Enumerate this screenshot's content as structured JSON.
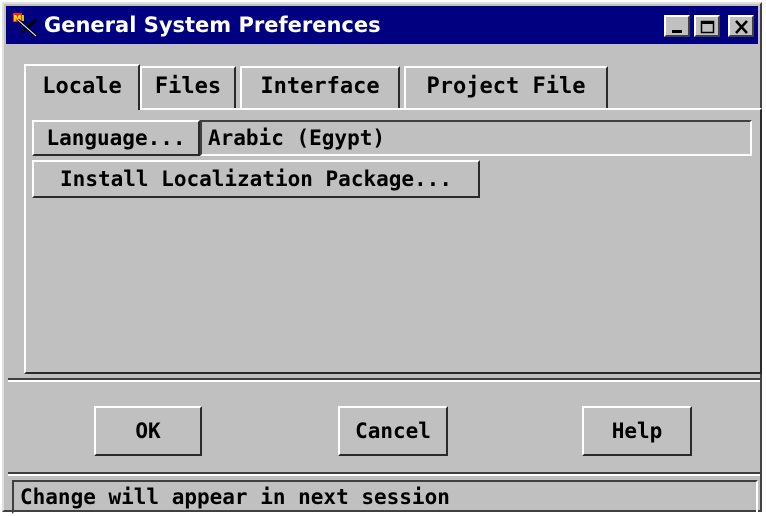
{
  "window": {
    "title": "General System Preferences",
    "titlebar_color": "#000080",
    "controls": [
      "minimize-icon",
      "maximize-icon",
      "close-icon"
    ]
  },
  "tabs": [
    {
      "label": "Locale",
      "active": true
    },
    {
      "label": "Files",
      "active": false
    },
    {
      "label": "Interface",
      "active": false
    },
    {
      "label": "Project File",
      "active": false
    }
  ],
  "locale": {
    "language_button": "Language...",
    "language_value": "Arabic (Egypt)",
    "install_button": "Install Localization Package..."
  },
  "buttons": {
    "ok": "OK",
    "cancel": "Cancel",
    "help": "Help"
  },
  "status_text": "Change will appear in next session"
}
